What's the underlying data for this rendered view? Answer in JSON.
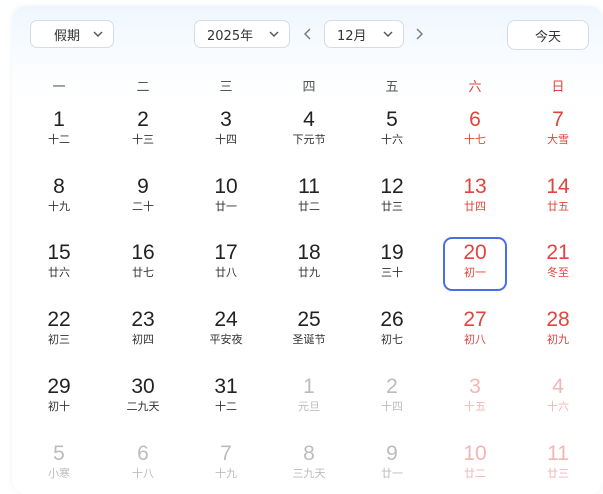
{
  "header": {
    "holiday_select": "假期",
    "year_select": "2025年",
    "month_select": "12月",
    "today_button": "今天",
    "icons": {
      "dropdown": "chevron-down-icon",
      "prev": "chevron-left-icon",
      "next": "chevron-right-icon"
    }
  },
  "weekdays": [
    "一",
    "二",
    "三",
    "四",
    "五",
    "六",
    "日"
  ],
  "colors": {
    "weekend": "#e0443e",
    "selected_border": "#4a6fe0",
    "other_month": "#bcbcbc"
  },
  "days": [
    {
      "n": "1",
      "l": "十二"
    },
    {
      "n": "2",
      "l": "十三"
    },
    {
      "n": "3",
      "l": "十四"
    },
    {
      "n": "4",
      "l": "下元节"
    },
    {
      "n": "5",
      "l": "十六"
    },
    {
      "n": "6",
      "l": "十七"
    },
    {
      "n": "7",
      "l": "大雪"
    },
    {
      "n": "8",
      "l": "十九"
    },
    {
      "n": "9",
      "l": "二十"
    },
    {
      "n": "10",
      "l": "廿一"
    },
    {
      "n": "11",
      "l": "廿二"
    },
    {
      "n": "12",
      "l": "廿三"
    },
    {
      "n": "13",
      "l": "廿四"
    },
    {
      "n": "14",
      "l": "廿五"
    },
    {
      "n": "15",
      "l": "廿六"
    },
    {
      "n": "16",
      "l": "廿七"
    },
    {
      "n": "17",
      "l": "廿八"
    },
    {
      "n": "18",
      "l": "廿九"
    },
    {
      "n": "19",
      "l": "三十"
    },
    {
      "n": "20",
      "l": "初一",
      "selected": true
    },
    {
      "n": "21",
      "l": "冬至"
    },
    {
      "n": "22",
      "l": "初三"
    },
    {
      "n": "23",
      "l": "初四"
    },
    {
      "n": "24",
      "l": "平安夜"
    },
    {
      "n": "25",
      "l": "圣诞节"
    },
    {
      "n": "26",
      "l": "初七"
    },
    {
      "n": "27",
      "l": "初八"
    },
    {
      "n": "28",
      "l": "初九"
    },
    {
      "n": "29",
      "l": "初十"
    },
    {
      "n": "30",
      "l": "二九天"
    },
    {
      "n": "31",
      "l": "十二"
    },
    {
      "n": "1",
      "l": "元旦",
      "other": true
    },
    {
      "n": "2",
      "l": "十四",
      "other": true
    },
    {
      "n": "3",
      "l": "十五",
      "other": true
    },
    {
      "n": "4",
      "l": "十六",
      "other": true
    },
    {
      "n": "5",
      "l": "小寒",
      "other": true
    },
    {
      "n": "6",
      "l": "十八",
      "other": true
    },
    {
      "n": "7",
      "l": "十九",
      "other": true
    },
    {
      "n": "8",
      "l": "三九天",
      "other": true
    },
    {
      "n": "9",
      "l": "廿一",
      "other": true
    },
    {
      "n": "10",
      "l": "廿二",
      "other": true
    },
    {
      "n": "11",
      "l": "廿三",
      "other": true
    }
  ]
}
